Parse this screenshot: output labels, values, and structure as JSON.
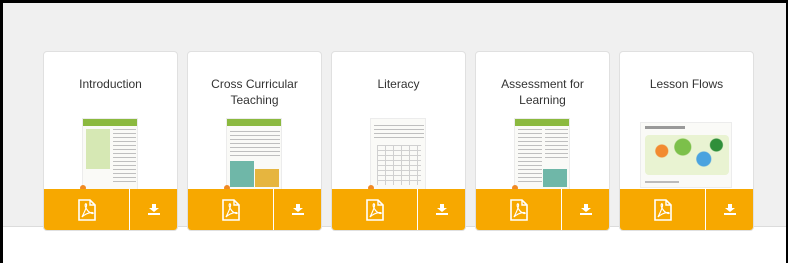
{
  "colors": {
    "accent": "#f7a800",
    "panel_background": "#f0f0f0",
    "card_background": "#ffffff",
    "thumbnail_band": "#8bb93f"
  },
  "icons": {
    "pdf": "pdf-file-icon",
    "download": "download-icon"
  },
  "cards": [
    {
      "title": "Introduction"
    },
    {
      "title": "Cross Curricular Teaching"
    },
    {
      "title": "Literacy"
    },
    {
      "title": "Assessment for Learning"
    },
    {
      "title": "Lesson Flows"
    }
  ]
}
